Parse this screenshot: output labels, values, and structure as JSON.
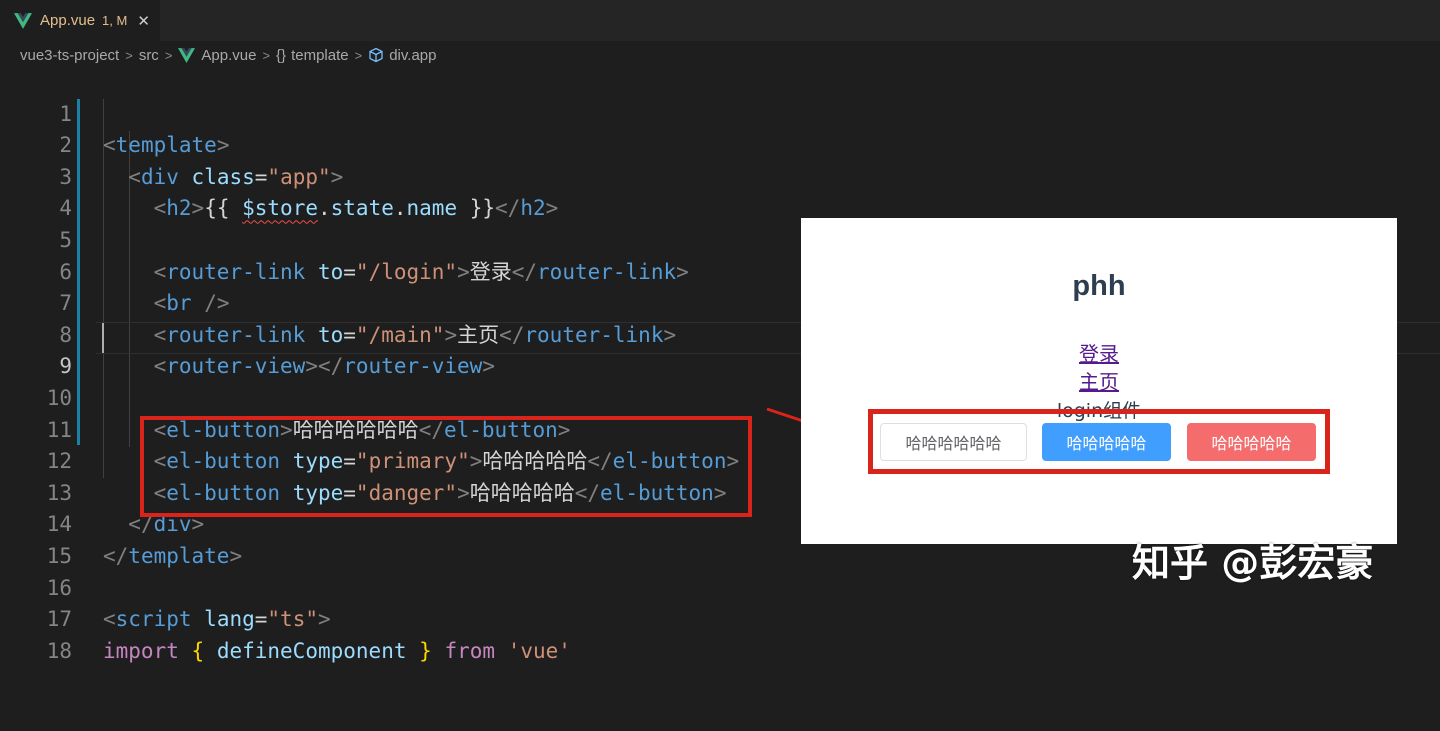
{
  "tab": {
    "filename": "App.vue",
    "status": "1, M",
    "close_glyph": "✕"
  },
  "breadcrumb": {
    "items": [
      "vue3-ts-project",
      "src",
      "App.vue",
      "template",
      "div.app"
    ],
    "braces": "{}"
  },
  "editor": {
    "active_line": 9,
    "line_numbers": [
      "1",
      "2",
      "3",
      "4",
      "5",
      "6",
      "7",
      "8",
      "9",
      "10",
      "11",
      "12",
      "13",
      "14",
      "15",
      "16",
      "17",
      "18"
    ]
  },
  "preview": {
    "title": "phh",
    "link_login": "登录",
    "link_main": "主页",
    "component_text": "login组件",
    "buttons": {
      "default": "哈哈哈哈哈哈",
      "primary": "哈哈哈哈哈",
      "danger": "哈哈哈哈哈"
    },
    "colors": {
      "primary": "#409eff",
      "danger": "#f56c6c",
      "title": "#2c3e50",
      "link": "#551a8b"
    }
  },
  "watermark": "知乎 @彭宏豪",
  "colors": {
    "editor_bg": "#1e1e1e",
    "highlight_box": "#d9241b",
    "tag": "#569cd6",
    "attribute": "#9cdcfe",
    "string": "#ce9178",
    "keyword": "#c586c0"
  },
  "icons": [
    "vue-logo-icon",
    "close-icon",
    "chevron-right-icon",
    "braces-icon",
    "cube-icon"
  ]
}
